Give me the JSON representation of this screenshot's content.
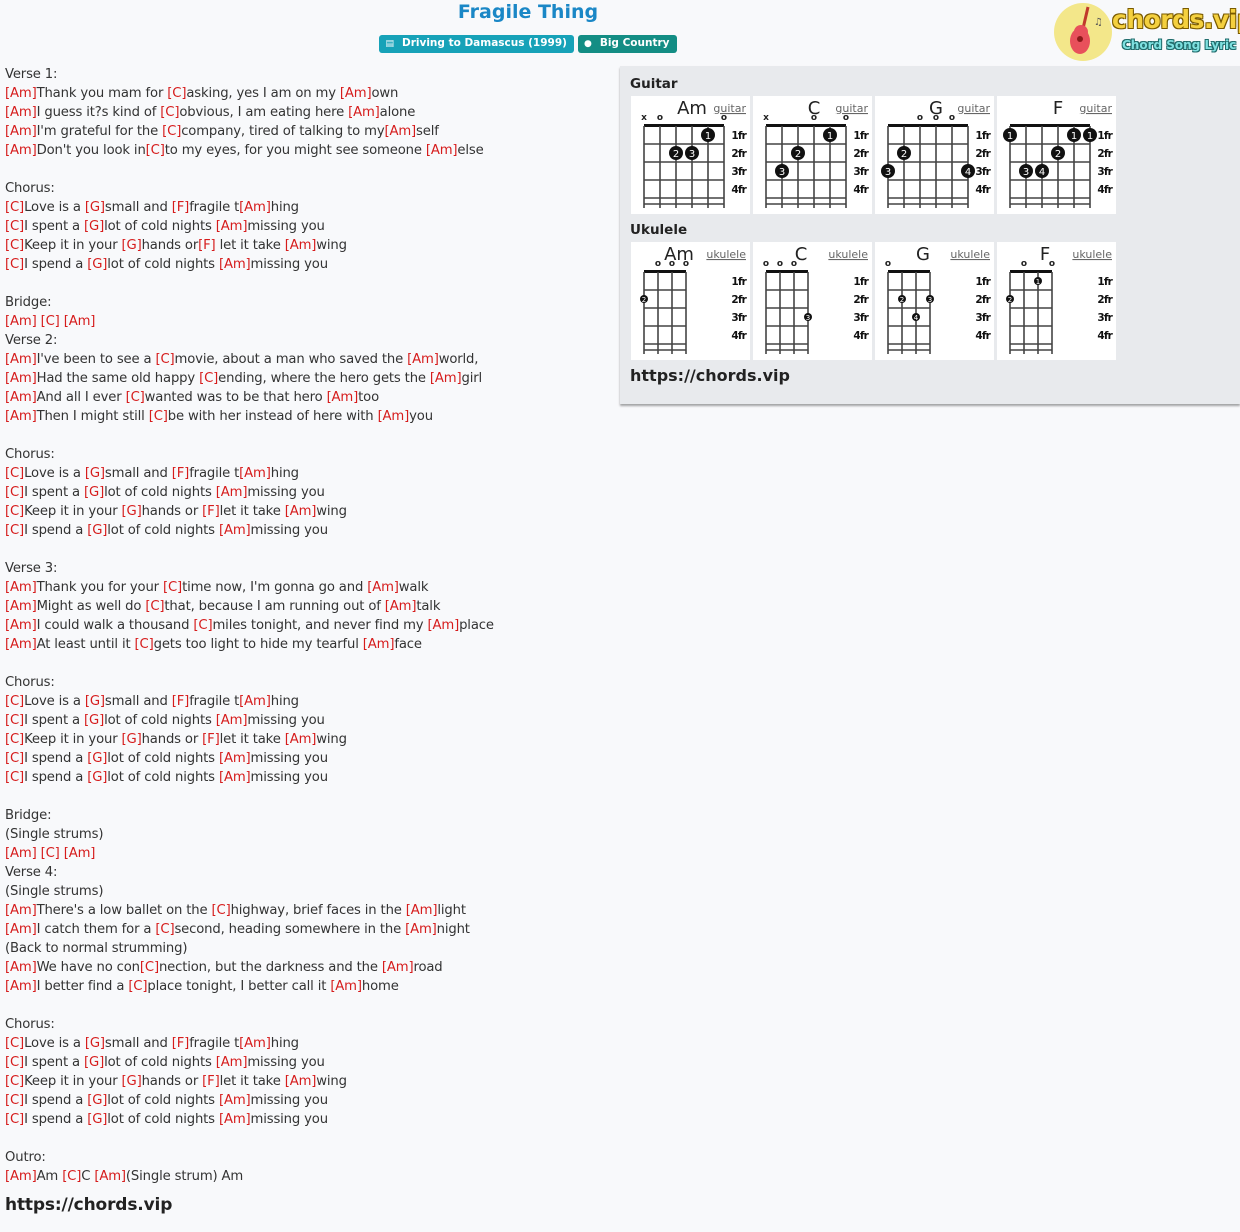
{
  "header": {
    "title": "Fragile Thing",
    "album_badge": {
      "icon": "book-icon",
      "label": "Driving to Damascus (1999)"
    },
    "artist_badge": {
      "icon": "user-icon",
      "label": "Big Country"
    },
    "logo": {
      "title": "chords.vip",
      "subtitle": "Chord Song Lyric"
    }
  },
  "colors": {
    "title": "#1a87c6",
    "chord": "#d61c1c",
    "album_badge": "#17a2b8",
    "artist_badge": "#138d84"
  },
  "lyrics": [
    [
      {
        "t": "Verse 1:"
      }
    ],
    [
      {
        "c": "[Am]"
      },
      {
        "t": "Thank you mam for "
      },
      {
        "c": "[C]"
      },
      {
        "t": "asking, yes I am on my "
      },
      {
        "c": "[Am]"
      },
      {
        "t": "own"
      }
    ],
    [
      {
        "c": "[Am]"
      },
      {
        "t": "I guess it?s kind of "
      },
      {
        "c": "[C]"
      },
      {
        "t": "obvious, I am eating here "
      },
      {
        "c": "[Am]"
      },
      {
        "t": "alone"
      }
    ],
    [
      {
        "c": "[Am]"
      },
      {
        "t": "I'm grateful for the "
      },
      {
        "c": "[C]"
      },
      {
        "t": "company, tired of talking to my"
      },
      {
        "c": "[Am]"
      },
      {
        "t": "self"
      }
    ],
    [
      {
        "c": "[Am]"
      },
      {
        "t": "Don't you look in"
      },
      {
        "c": "[C]"
      },
      {
        "t": "to my eyes, for you might see someone "
      },
      {
        "c": "[Am]"
      },
      {
        "t": "else"
      }
    ],
    [],
    [
      {
        "t": "Chorus:"
      }
    ],
    [
      {
        "c": "[C]"
      },
      {
        "t": "Love is a "
      },
      {
        "c": "[G]"
      },
      {
        "t": "small and "
      },
      {
        "c": "[F]"
      },
      {
        "t": "fragile t"
      },
      {
        "c": "[Am]"
      },
      {
        "t": "hing"
      }
    ],
    [
      {
        "c": "[C]"
      },
      {
        "t": "I spent a "
      },
      {
        "c": "[G]"
      },
      {
        "t": "lot of cold nights "
      },
      {
        "c": "[Am]"
      },
      {
        "t": "missing you"
      }
    ],
    [
      {
        "c": "[C]"
      },
      {
        "t": "Keep it in your "
      },
      {
        "c": "[G]"
      },
      {
        "t": "hands or"
      },
      {
        "c": "[F]"
      },
      {
        "t": " let it take "
      },
      {
        "c": "[Am]"
      },
      {
        "t": "wing"
      }
    ],
    [
      {
        "c": "[C]"
      },
      {
        "t": "I spend a "
      },
      {
        "c": "[G]"
      },
      {
        "t": "lot of cold nights "
      },
      {
        "c": "[Am]"
      },
      {
        "t": "missing you"
      }
    ],
    [],
    [
      {
        "t": "Bridge:"
      }
    ],
    [
      {
        "c": "[Am]"
      },
      {
        "t": " "
      },
      {
        "c": "[C]"
      },
      {
        "t": " "
      },
      {
        "c": "[Am]"
      }
    ],
    [
      {
        "t": "Verse 2:"
      }
    ],
    [
      {
        "c": "[Am]"
      },
      {
        "t": "I've been to see a "
      },
      {
        "c": "[C]"
      },
      {
        "t": "movie, about a man who saved the "
      },
      {
        "c": "[Am]"
      },
      {
        "t": "world,"
      }
    ],
    [
      {
        "c": "[Am]"
      },
      {
        "t": "Had the same old happy "
      },
      {
        "c": "[C]"
      },
      {
        "t": "ending, where the hero gets the "
      },
      {
        "c": "[Am]"
      },
      {
        "t": "girl"
      }
    ],
    [
      {
        "c": "[Am]"
      },
      {
        "t": "And all I ever "
      },
      {
        "c": "[C]"
      },
      {
        "t": "wanted was to be that hero "
      },
      {
        "c": "[Am]"
      },
      {
        "t": "too"
      }
    ],
    [
      {
        "c": "[Am]"
      },
      {
        "t": "Then I might still "
      },
      {
        "c": "[C]"
      },
      {
        "t": "be with her instead of here with "
      },
      {
        "c": "[Am]"
      },
      {
        "t": "you"
      }
    ],
    [],
    [
      {
        "t": "Chorus:"
      }
    ],
    [
      {
        "c": "[C]"
      },
      {
        "t": "Love is a "
      },
      {
        "c": "[G]"
      },
      {
        "t": "small and "
      },
      {
        "c": "[F]"
      },
      {
        "t": "fragile t"
      },
      {
        "c": "[Am]"
      },
      {
        "t": "hing"
      }
    ],
    [
      {
        "c": "[C]"
      },
      {
        "t": "I spent a "
      },
      {
        "c": "[G]"
      },
      {
        "t": "lot of cold nights "
      },
      {
        "c": "[Am]"
      },
      {
        "t": "missing you"
      }
    ],
    [
      {
        "c": "[C]"
      },
      {
        "t": "Keep it in your "
      },
      {
        "c": "[G]"
      },
      {
        "t": "hands or "
      },
      {
        "c": "[F]"
      },
      {
        "t": "let it take "
      },
      {
        "c": "[Am]"
      },
      {
        "t": "wing"
      }
    ],
    [
      {
        "c": "[C]"
      },
      {
        "t": "I spend a "
      },
      {
        "c": "[G]"
      },
      {
        "t": "lot of cold nights "
      },
      {
        "c": "[Am]"
      },
      {
        "t": "missing you"
      }
    ],
    [],
    [
      {
        "t": "Verse 3:"
      }
    ],
    [
      {
        "c": "[Am]"
      },
      {
        "t": "Thank you for your "
      },
      {
        "c": "[C]"
      },
      {
        "t": "time now, I'm gonna go and "
      },
      {
        "c": "[Am]"
      },
      {
        "t": "walk"
      }
    ],
    [
      {
        "c": "[Am]"
      },
      {
        "t": "Might as well do "
      },
      {
        "c": "[C]"
      },
      {
        "t": "that, because I am running out of "
      },
      {
        "c": "[Am]"
      },
      {
        "t": "talk"
      }
    ],
    [
      {
        "c": "[Am]"
      },
      {
        "t": "I could walk a thousand "
      },
      {
        "c": "[C]"
      },
      {
        "t": "miles tonight, and never find my "
      },
      {
        "c": "[Am]"
      },
      {
        "t": "place"
      }
    ],
    [
      {
        "c": "[Am]"
      },
      {
        "t": "At least until it "
      },
      {
        "c": "[C]"
      },
      {
        "t": "gets too light to hide my tearful "
      },
      {
        "c": "[Am]"
      },
      {
        "t": "face"
      }
    ],
    [],
    [
      {
        "t": "Chorus:"
      }
    ],
    [
      {
        "c": "[C]"
      },
      {
        "t": "Love is a "
      },
      {
        "c": "[G]"
      },
      {
        "t": "small and "
      },
      {
        "c": "[F]"
      },
      {
        "t": "fragile t"
      },
      {
        "c": "[Am]"
      },
      {
        "t": "hing"
      }
    ],
    [
      {
        "c": "[C]"
      },
      {
        "t": "I spent a "
      },
      {
        "c": "[G]"
      },
      {
        "t": "lot of cold nights "
      },
      {
        "c": "[Am]"
      },
      {
        "t": "missing you"
      }
    ],
    [
      {
        "c": "[C]"
      },
      {
        "t": "Keep it in your "
      },
      {
        "c": "[G]"
      },
      {
        "t": "hands or "
      },
      {
        "c": "[F]"
      },
      {
        "t": "let it take "
      },
      {
        "c": "[Am]"
      },
      {
        "t": "wing"
      }
    ],
    [
      {
        "c": "[C]"
      },
      {
        "t": "I spend a "
      },
      {
        "c": "[G]"
      },
      {
        "t": "lot of cold nights "
      },
      {
        "c": "[Am]"
      },
      {
        "t": "missing you"
      }
    ],
    [
      {
        "c": "[C]"
      },
      {
        "t": "I spend a "
      },
      {
        "c": "[G]"
      },
      {
        "t": "lot of cold nights "
      },
      {
        "c": "[Am]"
      },
      {
        "t": "missing you"
      }
    ],
    [],
    [
      {
        "t": "Bridge:"
      }
    ],
    [
      {
        "t": "(Single strums)"
      }
    ],
    [
      {
        "c": "[Am]"
      },
      {
        "t": " "
      },
      {
        "c": "[C]"
      },
      {
        "t": " "
      },
      {
        "c": "[Am]"
      }
    ],
    [
      {
        "t": "Verse 4:"
      }
    ],
    [
      {
        "t": "(Single strums)"
      }
    ],
    [
      {
        "c": "[Am]"
      },
      {
        "t": "There's a low ballet on the "
      },
      {
        "c": "[C]"
      },
      {
        "t": "highway, brief faces in the "
      },
      {
        "c": "[Am]"
      },
      {
        "t": "light"
      }
    ],
    [
      {
        "c": "[Am]"
      },
      {
        "t": "I catch them for a "
      },
      {
        "c": "[C]"
      },
      {
        "t": "second, heading somewhere in the "
      },
      {
        "c": "[Am]"
      },
      {
        "t": "night"
      }
    ],
    [
      {
        "t": "(Back to normal strumming)"
      }
    ],
    [
      {
        "c": "[Am]"
      },
      {
        "t": "We have no con"
      },
      {
        "c": "[C]"
      },
      {
        "t": "nection, but the darkness and the "
      },
      {
        "c": "[Am]"
      },
      {
        "t": "road"
      }
    ],
    [
      {
        "c": "[Am]"
      },
      {
        "t": "I better find a "
      },
      {
        "c": "[C]"
      },
      {
        "t": "place tonight, I better call it "
      },
      {
        "c": "[Am]"
      },
      {
        "t": "home"
      }
    ],
    [],
    [
      {
        "t": "Chorus:"
      }
    ],
    [
      {
        "c": "[C]"
      },
      {
        "t": "Love is a "
      },
      {
        "c": "[G]"
      },
      {
        "t": "small and "
      },
      {
        "c": "[F]"
      },
      {
        "t": "fragile t"
      },
      {
        "c": "[Am]"
      },
      {
        "t": "hing"
      }
    ],
    [
      {
        "c": "[C]"
      },
      {
        "t": "I spent a "
      },
      {
        "c": "[G]"
      },
      {
        "t": "lot of cold nights "
      },
      {
        "c": "[Am]"
      },
      {
        "t": "missing you"
      }
    ],
    [
      {
        "c": "[C]"
      },
      {
        "t": "Keep it in your "
      },
      {
        "c": "[G]"
      },
      {
        "t": "hands or "
      },
      {
        "c": "[F]"
      },
      {
        "t": "let it take "
      },
      {
        "c": "[Am]"
      },
      {
        "t": "wing"
      }
    ],
    [
      {
        "c": "[C]"
      },
      {
        "t": "I spend a "
      },
      {
        "c": "[G]"
      },
      {
        "t": "lot of cold nights "
      },
      {
        "c": "[Am]"
      },
      {
        "t": "missing you"
      }
    ],
    [
      {
        "c": "[C]"
      },
      {
        "t": "I spend a "
      },
      {
        "c": "[G]"
      },
      {
        "t": "lot of cold nights "
      },
      {
        "c": "[Am]"
      },
      {
        "t": "missing you"
      }
    ],
    [],
    [
      {
        "t": "Outro:"
      }
    ],
    [
      {
        "c": "[Am]"
      },
      {
        "t": "Am "
      },
      {
        "c": "[C]"
      },
      {
        "t": "C "
      },
      {
        "c": "[Am]"
      },
      {
        "t": "(Single strum) Am"
      }
    ]
  ],
  "lyrics_footer_url": "https://chords.vip",
  "chord_panel": {
    "guitar_title": "Guitar",
    "ukulele_title": "Ukulele",
    "fret_labels": [
      "1fr",
      "2fr",
      "3fr",
      "4fr"
    ],
    "footer_url": "https://chords.vip",
    "guitar": [
      {
        "name": "Am",
        "link": "guitar",
        "markers": [
          "x",
          "o",
          "",
          "",
          "",
          "o"
        ],
        "dots": [
          {
            "s": 4,
            "f": 1,
            "n": "1"
          },
          {
            "s": 2,
            "f": 2,
            "n": "2"
          },
          {
            "s": 3,
            "f": 2,
            "n": "3"
          }
        ]
      },
      {
        "name": "C",
        "link": "guitar",
        "markers": [
          "x",
          "",
          "",
          "o",
          "",
          "o"
        ],
        "dots": [
          {
            "s": 4,
            "f": 1,
            "n": "1"
          },
          {
            "s": 2,
            "f": 2,
            "n": "2"
          },
          {
            "s": 1,
            "f": 3,
            "n": "3"
          }
        ]
      },
      {
        "name": "G",
        "link": "guitar",
        "markers": [
          "",
          "",
          "o",
          "o",
          "o",
          ""
        ],
        "dots": [
          {
            "s": 1,
            "f": 2,
            "n": "2"
          },
          {
            "s": 0,
            "f": 3,
            "n": "3"
          },
          {
            "s": 5,
            "f": 3,
            "n": "4"
          }
        ]
      },
      {
        "name": "F",
        "link": "guitar",
        "markers": [
          "",
          "",
          "",
          "",
          "",
          ""
        ],
        "dots": [
          {
            "s": 0,
            "f": 1,
            "n": "1"
          },
          {
            "s": 4,
            "f": 1,
            "n": "1"
          },
          {
            "s": 5,
            "f": 1,
            "n": "1"
          },
          {
            "s": 3,
            "f": 2,
            "n": "2"
          },
          {
            "s": 1,
            "f": 3,
            "n": "3"
          },
          {
            "s": 2,
            "f": 3,
            "n": "4"
          }
        ]
      }
    ],
    "ukulele": [
      {
        "name": "Am",
        "link": "ukulele",
        "markers": [
          "",
          "o",
          "o",
          "o"
        ],
        "dots": [
          {
            "s": 0,
            "f": 2,
            "n": "2"
          }
        ]
      },
      {
        "name": "C",
        "link": "ukulele",
        "markers": [
          "o",
          "o",
          "o",
          ""
        ],
        "dots": [
          {
            "s": 3,
            "f": 3,
            "n": "3"
          }
        ]
      },
      {
        "name": "G",
        "link": "ukulele",
        "markers": [
          "o",
          "",
          "",
          ""
        ],
        "dots": [
          {
            "s": 1,
            "f": 2,
            "n": "2"
          },
          {
            "s": 3,
            "f": 2,
            "n": "3"
          },
          {
            "s": 2,
            "f": 3,
            "n": "4"
          }
        ]
      },
      {
        "name": "F",
        "link": "ukulele",
        "markers": [
          "",
          "o",
          "",
          "o"
        ],
        "dots": [
          {
            "s": 2,
            "f": 1,
            "n": "1"
          },
          {
            "s": 0,
            "f": 2,
            "n": "2"
          }
        ]
      }
    ]
  }
}
